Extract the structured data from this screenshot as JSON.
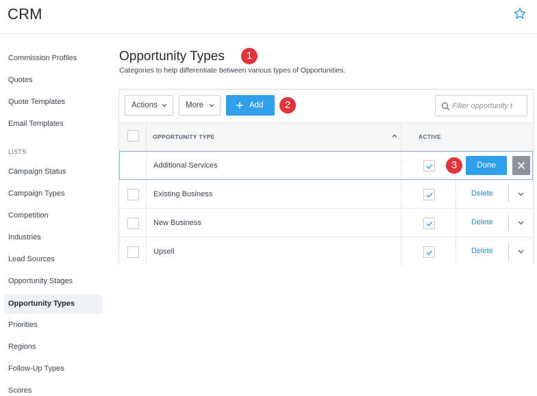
{
  "header": {
    "title": "CRM",
    "favorite_icon": "star-outline-icon"
  },
  "sidebar": {
    "items_top": [
      {
        "label": "Commission Profiles"
      },
      {
        "label": "Quotes"
      },
      {
        "label": "Quote Templates"
      },
      {
        "label": "Email Templates"
      }
    ],
    "lists_heading": "LISTS",
    "items_lists": [
      {
        "label": "Campaign Status"
      },
      {
        "label": "Campaign Types"
      },
      {
        "label": "Competition"
      },
      {
        "label": "Industries"
      },
      {
        "label": "Lead Sources"
      },
      {
        "label": "Opportunity Stages"
      },
      {
        "label": "Opportunity Types",
        "active": true
      },
      {
        "label": "Priorities"
      },
      {
        "label": "Regions"
      },
      {
        "label": "Follow-Up Types"
      },
      {
        "label": "Scores"
      }
    ]
  },
  "main": {
    "title": "Opportunity Types",
    "description": "Categories to help differentiate between various types of Opportunities.",
    "badges": [
      "1",
      "2",
      "3"
    ],
    "toolbar": {
      "actions_label": "Actions",
      "more_label": "More",
      "add_label": "Add",
      "filter_placeholder": "Filter opportunity t"
    },
    "table": {
      "columns": [
        "OPPORTUNITY TYPE",
        "ACTIVE"
      ],
      "rows": [
        {
          "name": "Additional Services",
          "active": true,
          "editing": true,
          "done_label": "Done"
        },
        {
          "name": "Existing Business",
          "active": true,
          "action_label": "Delete"
        },
        {
          "name": "New Business",
          "active": true,
          "action_label": "Delete"
        },
        {
          "name": "Upsell",
          "active": true,
          "action_label": "Delete"
        }
      ]
    }
  },
  "colors": {
    "accent": "#2f9fea",
    "badge": "#e0353a",
    "link": "#2a8bd9",
    "cancel_button": "#8e949b"
  }
}
